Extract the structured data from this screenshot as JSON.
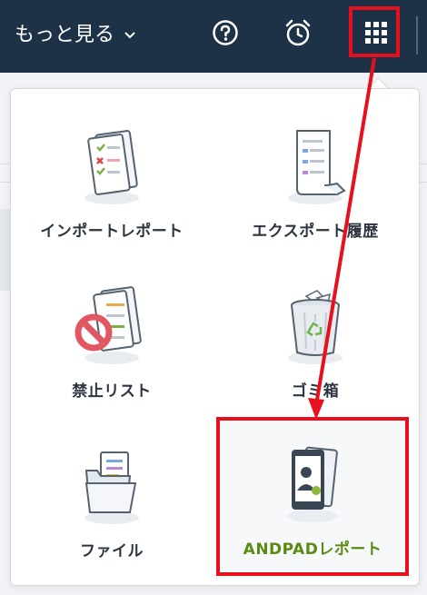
{
  "topbar": {
    "more_label": "もっと見る",
    "icons": [
      "help-icon",
      "alarm-clock-icon",
      "apps-grid-icon"
    ]
  },
  "menu": {
    "items": [
      {
        "label": "インポートレポート",
        "icon": "import-report-icon"
      },
      {
        "label": "エクスポート履歴",
        "icon": "export-history-icon"
      },
      {
        "label": "禁止リスト",
        "icon": "prohibited-list-icon"
      },
      {
        "label": "ゴミ箱",
        "icon": "trash-bin-icon"
      },
      {
        "label": "ファイル",
        "icon": "folder-icon"
      },
      {
        "label": "ANDPADレポート",
        "icon": "andpad-report-icon"
      }
    ]
  },
  "colors": {
    "header_bg": "#1d3147",
    "highlight": "#e8101c",
    "active_label": "#5a8a12"
  }
}
